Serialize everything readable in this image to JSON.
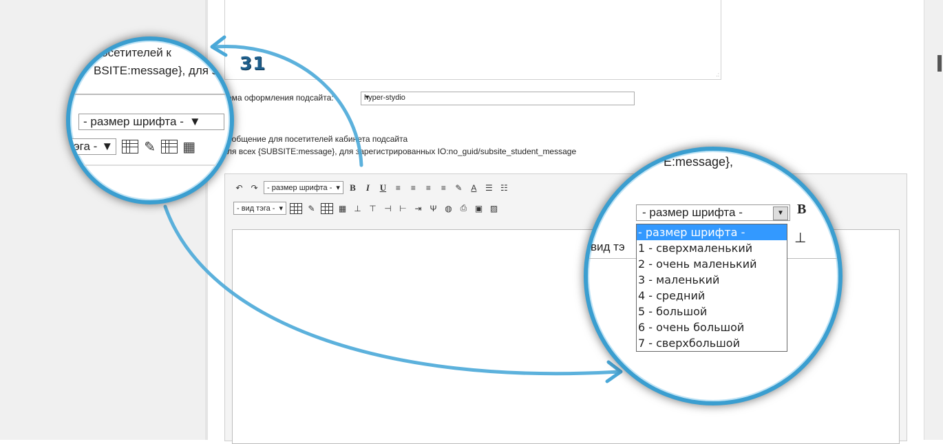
{
  "step_number": "31",
  "theme": {
    "label": "ема оформления подсайта:",
    "value": "hyper-stydio"
  },
  "message": {
    "title": "ообщение для посетителей кабинета подсайта",
    "hint": "ля всех {SUBSITE:message}, для зарегистрированных IO:no_guid/subsite_student_message"
  },
  "toolbar": {
    "font_size_select": "- размер шрифта -",
    "tag_select": "- вид тэга -",
    "undo_icon": "undo-icon",
    "redo_icon": "redo-icon"
  },
  "magnifier_left": {
    "text_line1": "посетителей к",
    "text_line2": "BSITE:message}, для з",
    "font_select": "- размер шрифта -",
    "tag_select": "эга -"
  },
  "magnifier_right": {
    "text_top": "E:message},",
    "font_select": "- размер шрифта -",
    "behind_text": "вид тэ",
    "options": [
      "- размер шрифта -",
      "1 - сверхмаленький",
      "2 - очень маленький",
      "3 - маленький",
      "4 - средний",
      "5 - большой",
      "6 - очень большой",
      "7 - сверхбольшой"
    ],
    "selected_index": 0
  },
  "colors": {
    "accent": "#3a9ed0",
    "highlight": "#3399ff",
    "step_number": "#1f5f8c"
  }
}
